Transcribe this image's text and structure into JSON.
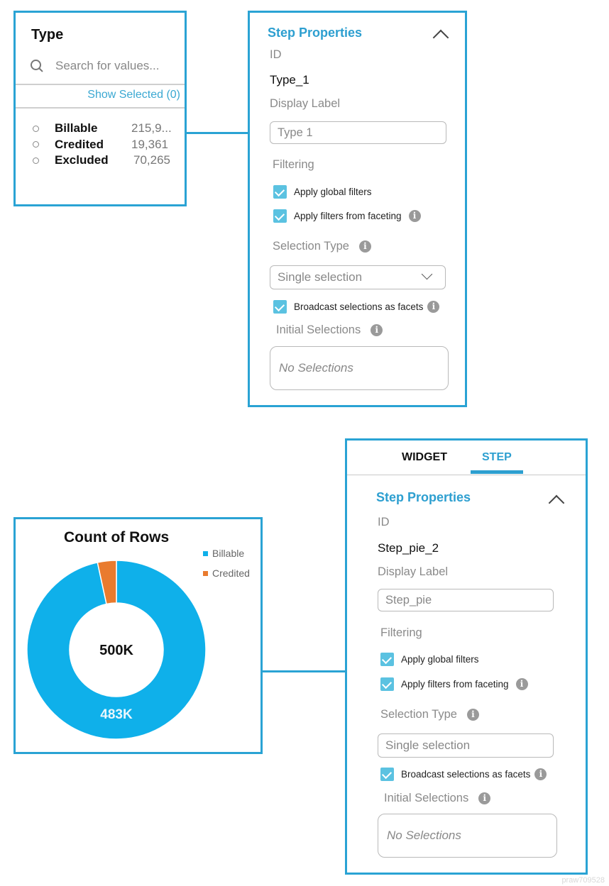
{
  "type_filter": {
    "title": "Type",
    "search_placeholder": "Search for values...",
    "show_selected": "Show Selected (0)",
    "values": [
      {
        "label": "Billable",
        "count": "215,9..."
      },
      {
        "label": "Credited",
        "count": "19,361"
      },
      {
        "label": "Excluded",
        "count": "70,265"
      }
    ]
  },
  "step_panel_1": {
    "title": "Step Properties",
    "id_label": "ID",
    "id_value": "Type_1",
    "display_label_label": "Display Label",
    "display_label_value": "Type 1",
    "filtering_label": "Filtering",
    "apply_global_filters": "Apply global filters",
    "apply_global_filters_checked": true,
    "apply_filters_faceting": "Apply filters from faceting",
    "apply_filters_faceting_checked": true,
    "selection_type_label": "Selection Type",
    "selection_type_value": "Single selection",
    "broadcast_label": "Broadcast selections as facets",
    "broadcast_checked": true,
    "initial_selections_label": "Initial Selections",
    "initial_selections_value": "No Selections"
  },
  "step_panel_2": {
    "tabs": [
      {
        "label": "WIDGET",
        "active": false
      },
      {
        "label": "STEP",
        "active": true
      }
    ],
    "title": "Step Properties",
    "id_label": "ID",
    "id_value": "Step_pie_2",
    "display_label_label": "Display Label",
    "display_label_value": "Step_pie",
    "filtering_label": "Filtering",
    "apply_global_filters": "Apply global filters",
    "apply_global_filters_checked": true,
    "apply_filters_faceting": "Apply filters from faceting",
    "apply_filters_faceting_checked": true,
    "selection_type_label": "Selection Type",
    "selection_type_value": "Single selection",
    "broadcast_label": "Broadcast selections as facets",
    "broadcast_checked": true,
    "initial_selections_label": "Initial Selections",
    "initial_selections_value": "No Selections"
  },
  "icons": {
    "info": "i"
  },
  "colors": {
    "accent": "#2d9fd0",
    "border": "#2aa3d4",
    "billable": "#0fb0ea",
    "credited": "#e97b2e",
    "checkbox": "#5bc2e1"
  },
  "chart_data": {
    "type": "pie",
    "variant": "donut",
    "title": "Count of Rows",
    "center_label": "500K",
    "categories": [
      "Billable",
      "Credited"
    ],
    "values": [
      483,
      17
    ],
    "unit": "K",
    "data_labels": [
      "483K",
      ""
    ],
    "legend": "top-right",
    "colors": [
      "#0fb0ea",
      "#e97b2e"
    ]
  },
  "watermark": "praw709528"
}
